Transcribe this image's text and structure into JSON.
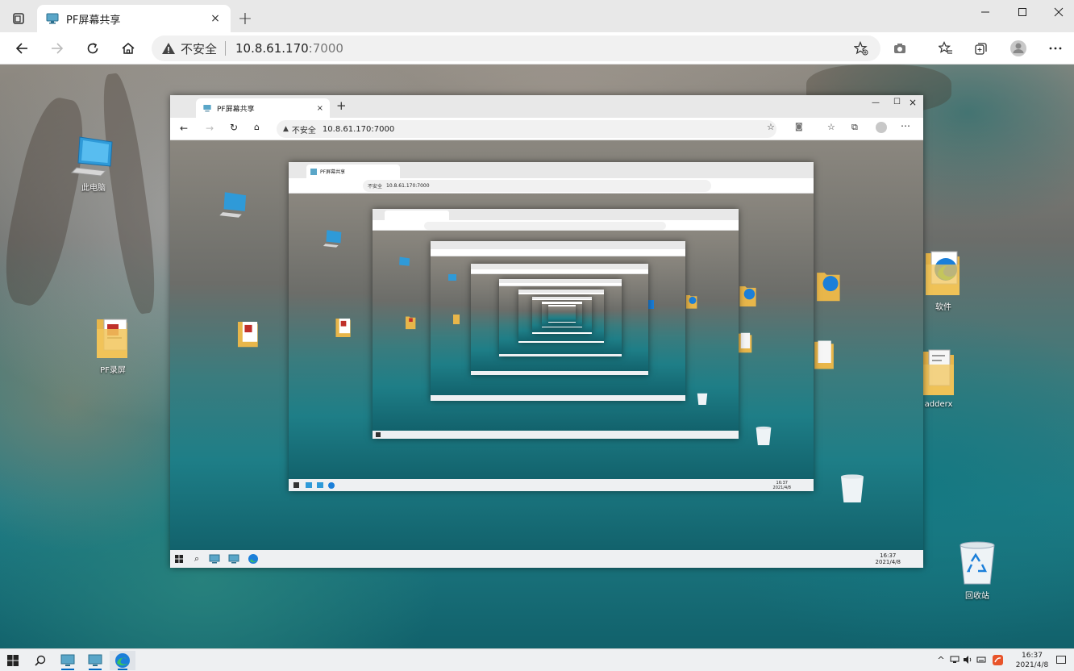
{
  "browser": {
    "tab_title": "PF屏幕共享",
    "new_tab": "+",
    "tab_close": "×",
    "address": {
      "insecure_label": "不安全",
      "host": "10.8.61.170",
      "port": ":7000"
    }
  },
  "desktop": {
    "icons": [
      {
        "name": "此电脑",
        "icon": "computer-icon"
      },
      {
        "name": "PF录屏",
        "icon": "folder-icon"
      },
      {
        "name": "软件",
        "icon": "folder-edge-icon"
      },
      {
        "name": "adderx",
        "icon": "folder-icon"
      },
      {
        "name": "回收站",
        "icon": "recycle-bin-icon"
      }
    ]
  },
  "nested_frames": {
    "tab_title": "PF屏幕共享",
    "insecure_label": "不安全",
    "url": "10.8.61.170:7000",
    "clock_time": "16:37",
    "clock_date": "2021/4/8"
  },
  "taskbar": {
    "clock_time": "16:37",
    "clock_date": "2021/4/8",
    "apps": [
      "start-icon",
      "search-icon",
      "pf-monitor-icon",
      "pf-monitor-icon",
      "edge-icon"
    ]
  },
  "colors": {
    "accent": "#0067c0",
    "chrome_bg": "#e8e8e8",
    "edge_blue": "#1b7fd9",
    "edge_green": "#3cc45c"
  }
}
